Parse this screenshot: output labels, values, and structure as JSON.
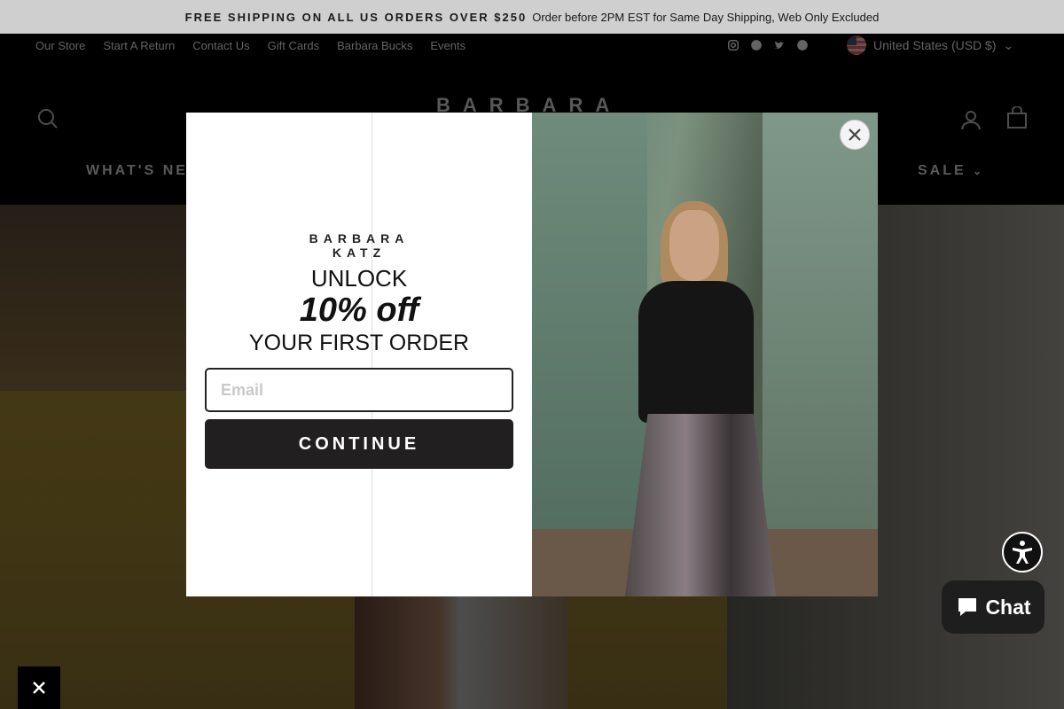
{
  "announcement": {
    "bold": "FREE SHIPPING ON ALL US ORDERS OVER $250",
    "text": "Order before 2PM EST for Same Day Shipping, Web Only Excluded"
  },
  "utility_links": [
    "Our Store",
    "Start A Return",
    "Contact Us",
    "Gift Cards",
    "Barbara Bucks",
    "Events"
  ],
  "social_icons": [
    "instagram-icon",
    "facebook-icon",
    "twitter-icon",
    "pinterest-icon"
  ],
  "currency": "United States (USD $)",
  "brand": "BARBARA",
  "nav": {
    "whats_new": "WHAT'S NEW",
    "sale": "SALE"
  },
  "popup": {
    "logo_line1": "BARBARA",
    "logo_line2": "KATZ",
    "unlock": "UNLOCK",
    "offer": "10% off",
    "first_order": "YOUR FIRST ORDER",
    "email_placeholder": "Email",
    "continue": "CONTINUE"
  },
  "chat": {
    "label": "Chat"
  },
  "colors": {
    "button": "#221f20",
    "announce_bg": "#cfcfcf"
  }
}
